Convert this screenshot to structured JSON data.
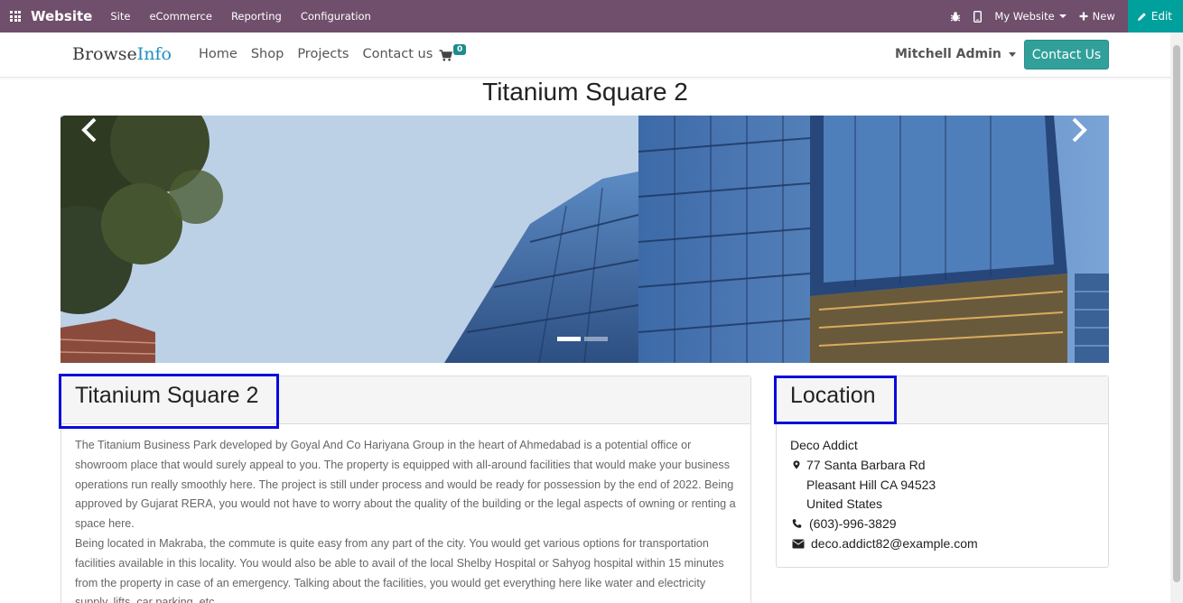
{
  "topbar": {
    "brand": "Website",
    "menus": [
      "Site",
      "eCommerce",
      "Reporting",
      "Configuration"
    ],
    "website_selector": "My Website",
    "new_label": "New",
    "edit_label": "Edit"
  },
  "header": {
    "logo_part1": "Browse",
    "logo_part2": "Info",
    "nav": [
      "Home",
      "Shop",
      "Projects",
      "Contact us"
    ],
    "cart_count": "0",
    "user": "Mitchell Admin",
    "contact_button": "Contact Us"
  },
  "page": {
    "title": "Titanium Square 2"
  },
  "carousel": {
    "indicators": 2,
    "active_index": 0
  },
  "project_panel": {
    "title": "Titanium Square 2",
    "paragraph1": "The Titanium Business Park developed by Goyal And Co Hariyana Group in the heart of Ahmedabad is a potential office or showroom place that would surely appeal to you. The property is equipped with all-around facilities that would make your business operations run really smoothly here. The project is still under process and would be ready for possession by the end of 2022. Being approved by Gujarat RERA, you would not have to worry about the quality of the building or the legal aspects of owning or renting a space here.",
    "paragraph2": "Being located in Makraba, the commute is quite easy from any part of the city. You would get various options for transportation facilities available in this locality. You would also be able to avail of the local Shelby Hospital or Sahyog hospital within 15 minutes from the property in case of an emergency. Talking about the facilities, you would get everything here like water and electricity supply, lifts, car parking, etc."
  },
  "location_panel": {
    "title": "Location",
    "company": "Deco Addict",
    "street": "77 Santa Barbara Rd",
    "city_line": "Pleasant Hill CA 94523",
    "country": "United States",
    "phone": "(603)-996-3829",
    "email": "deco.addict82@example.com"
  },
  "colors": {
    "topbar": "#6f4f6b",
    "edit_button": "#00a09d",
    "accent": "#31a09b",
    "highlight_box": "#0a0adc"
  },
  "icons": [
    "apps-grid-icon",
    "bug-icon",
    "mobile-icon",
    "plus-icon",
    "pencil-icon",
    "cart-icon",
    "chevron-left-icon",
    "chevron-right-icon",
    "map-marker-icon",
    "phone-icon",
    "envelope-icon"
  ]
}
